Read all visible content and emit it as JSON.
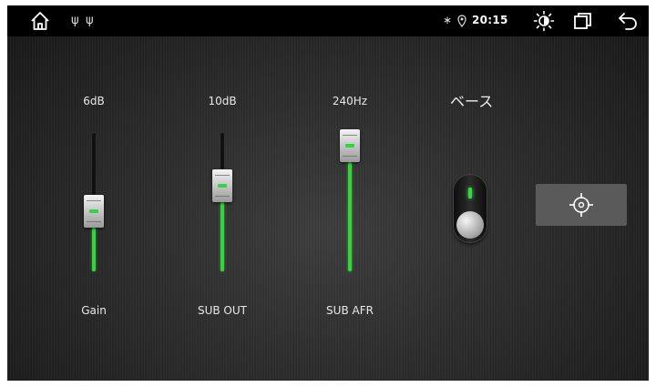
{
  "status_bar": {
    "time": "20:15",
    "icons": [
      "home-icon",
      "usb-icon",
      "usb-icon",
      "bluetooth-icon",
      "location-icon",
      "brightness-icon",
      "recent-apps-icon",
      "back-icon"
    ]
  },
  "sliders": [
    {
      "value_label": "6dB",
      "name": "Gain",
      "level": 0.38
    },
    {
      "value_label": "10dB",
      "name": "SUB OUT",
      "level": 0.62
    },
    {
      "value_label": "240Hz",
      "name": "SUB AFR",
      "level": 1.0
    }
  ],
  "bass": {
    "label": "ベース",
    "state": "on"
  },
  "target_button": {
    "icon": "target-icon"
  },
  "colors": {
    "accent_green": "#35d43f",
    "status_bar": "#000000",
    "button_bg": "#5a5a5a"
  }
}
